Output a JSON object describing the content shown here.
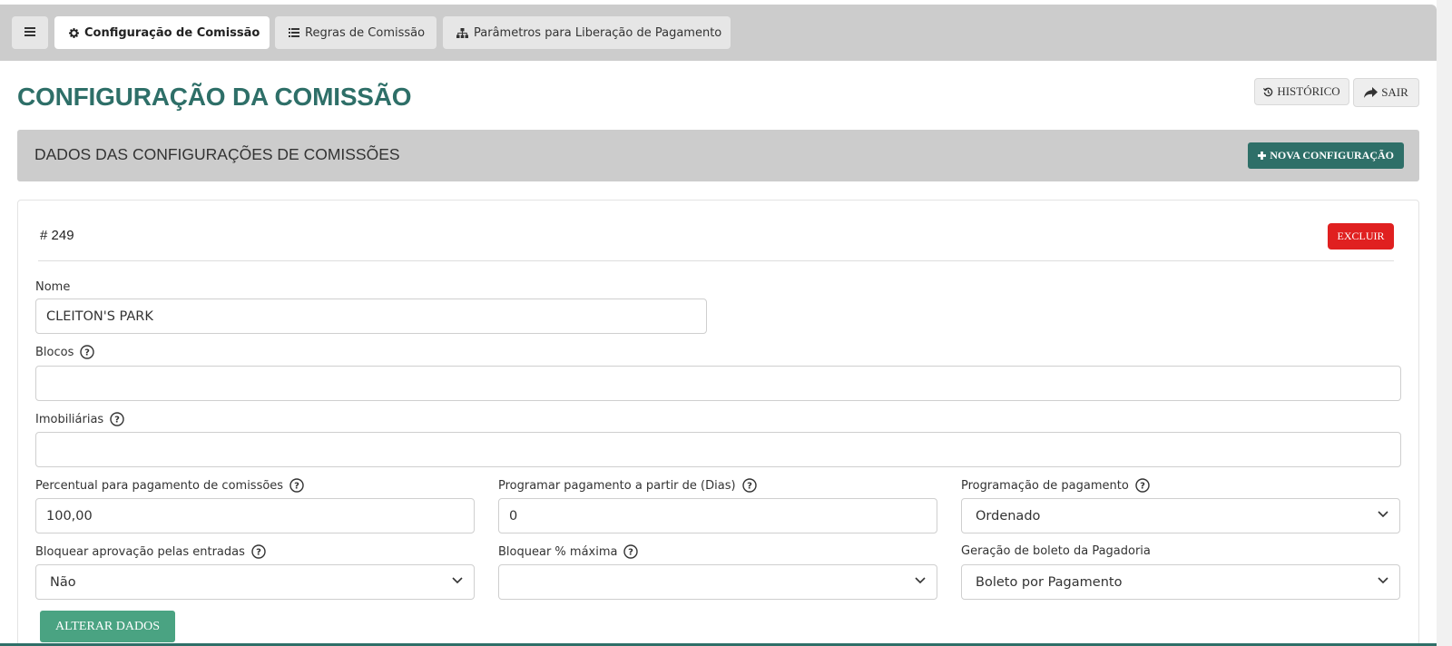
{
  "tabs": {
    "config": "Configuração de Comissão",
    "regras": "Regras de Comissão",
    "params": "Parâmetros para Liberação de Pagamento"
  },
  "page": {
    "title": "CONFIGURAÇÃO DA COMISSÃO",
    "historico": "HISTÓRICO",
    "sair": "SAIR"
  },
  "section": {
    "title": "DADOS DAS CONFIGURAÇÕES DE COMISSÕES",
    "nova": "NOVA CONFIGURAÇÃO"
  },
  "card": {
    "id": "# 249",
    "excluir": "EXCLUIR"
  },
  "form": {
    "nome_label": "Nome",
    "nome_value": "CLEITON'S PARK",
    "blocos_label": "Blocos",
    "blocos_value": "",
    "imob_label": "Imobiliárias",
    "imob_value": "",
    "percentual_label": "Percentual para pagamento de comissões",
    "percentual_value": "100,00",
    "programar_label": "Programar pagamento a partir de (Dias)",
    "programar_value": "0",
    "programacao_label": "Programação de pagamento",
    "programacao_value": "Ordenado",
    "bloq_aprov_label": "Bloquear aprovação pelas entradas",
    "bloq_aprov_value": "Não",
    "bloq_max_label": "Bloquear % máxima",
    "bloq_max_value": "",
    "boleto_label": "Geração de boleto da Pagadoria",
    "boleto_value": "Boleto por Pagamento"
  },
  "actions": {
    "alterar": "ALTERAR DADOS"
  },
  "colors": {
    "brand": "#2e6f68",
    "danger": "#e02020",
    "success": "#4aa382"
  }
}
